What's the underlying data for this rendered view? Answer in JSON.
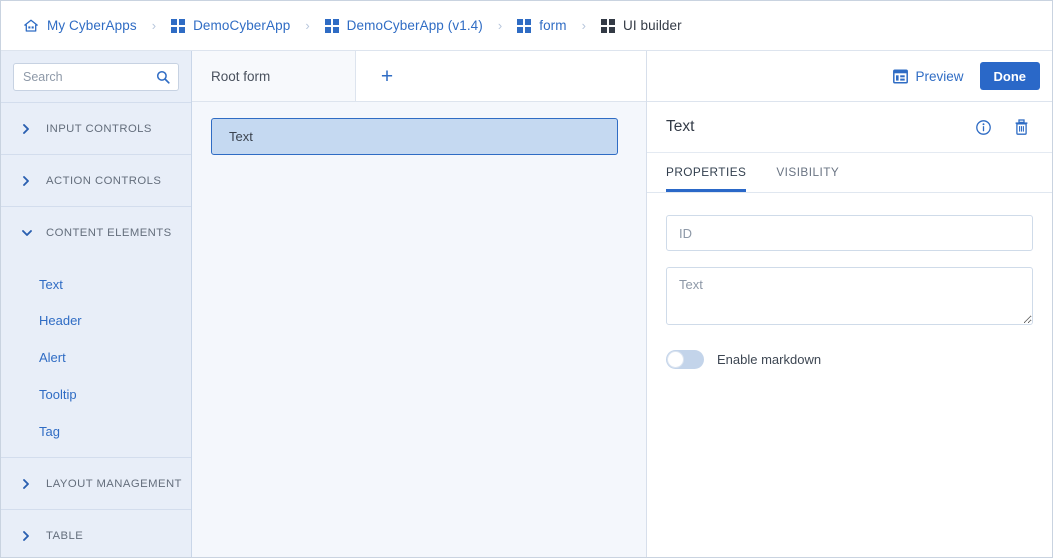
{
  "breadcrumb": {
    "items": [
      {
        "label": "My CyberApps",
        "icon": "home-icon",
        "current": false
      },
      {
        "label": "DemoCyberApp",
        "icon": "grid-icon",
        "current": false
      },
      {
        "label": "DemoCyberApp (v1.4)",
        "icon": "grid-icon",
        "current": false
      },
      {
        "label": "form",
        "icon": "grid-icon",
        "current": false
      },
      {
        "label": "UI builder",
        "icon": "grid-icon-dark",
        "current": true
      }
    ],
    "separator": "›"
  },
  "sidebar": {
    "search": {
      "placeholder": "Search",
      "value": "",
      "icon": "search-icon"
    },
    "sections": [
      {
        "label": "INPUT CONTROLS",
        "expanded": false,
        "items": []
      },
      {
        "label": "ACTION CONTROLS",
        "expanded": false,
        "items": []
      },
      {
        "label": "CONTENT ELEMENTS",
        "expanded": true,
        "items": [
          "Text",
          "Header",
          "Alert",
          "Tooltip",
          "Tag"
        ]
      },
      {
        "label": "LAYOUT MANAGEMENT",
        "expanded": false,
        "items": []
      },
      {
        "label": "TABLE",
        "expanded": false,
        "items": []
      }
    ]
  },
  "canvas": {
    "tabs": [
      {
        "label": "Root form",
        "active": true
      }
    ],
    "add_tab_label": "+",
    "elements": [
      {
        "label": "Text",
        "selected": true
      }
    ]
  },
  "right_panel": {
    "preview_label": "Preview",
    "preview_icon": "layout-preview-icon",
    "done_label": "Done",
    "title": "Text",
    "info_icon": "info-circle-icon",
    "delete_icon": "trash-icon",
    "tabs": [
      {
        "label": "PROPERTIES",
        "active": true
      },
      {
        "label": "VISIBILITY",
        "active": false
      }
    ],
    "fields": {
      "id": {
        "placeholder": "ID",
        "value": ""
      },
      "text": {
        "placeholder": "Text",
        "value": ""
      }
    },
    "toggle": {
      "label": "Enable markdown",
      "on": false
    }
  },
  "colors": {
    "accent": "#2a68c8",
    "link": "#2f6cc4",
    "sidebar_bg": "#e8eef8",
    "canvas_bg": "#f4f7fc",
    "selected_fill": "#c5d9f1"
  }
}
